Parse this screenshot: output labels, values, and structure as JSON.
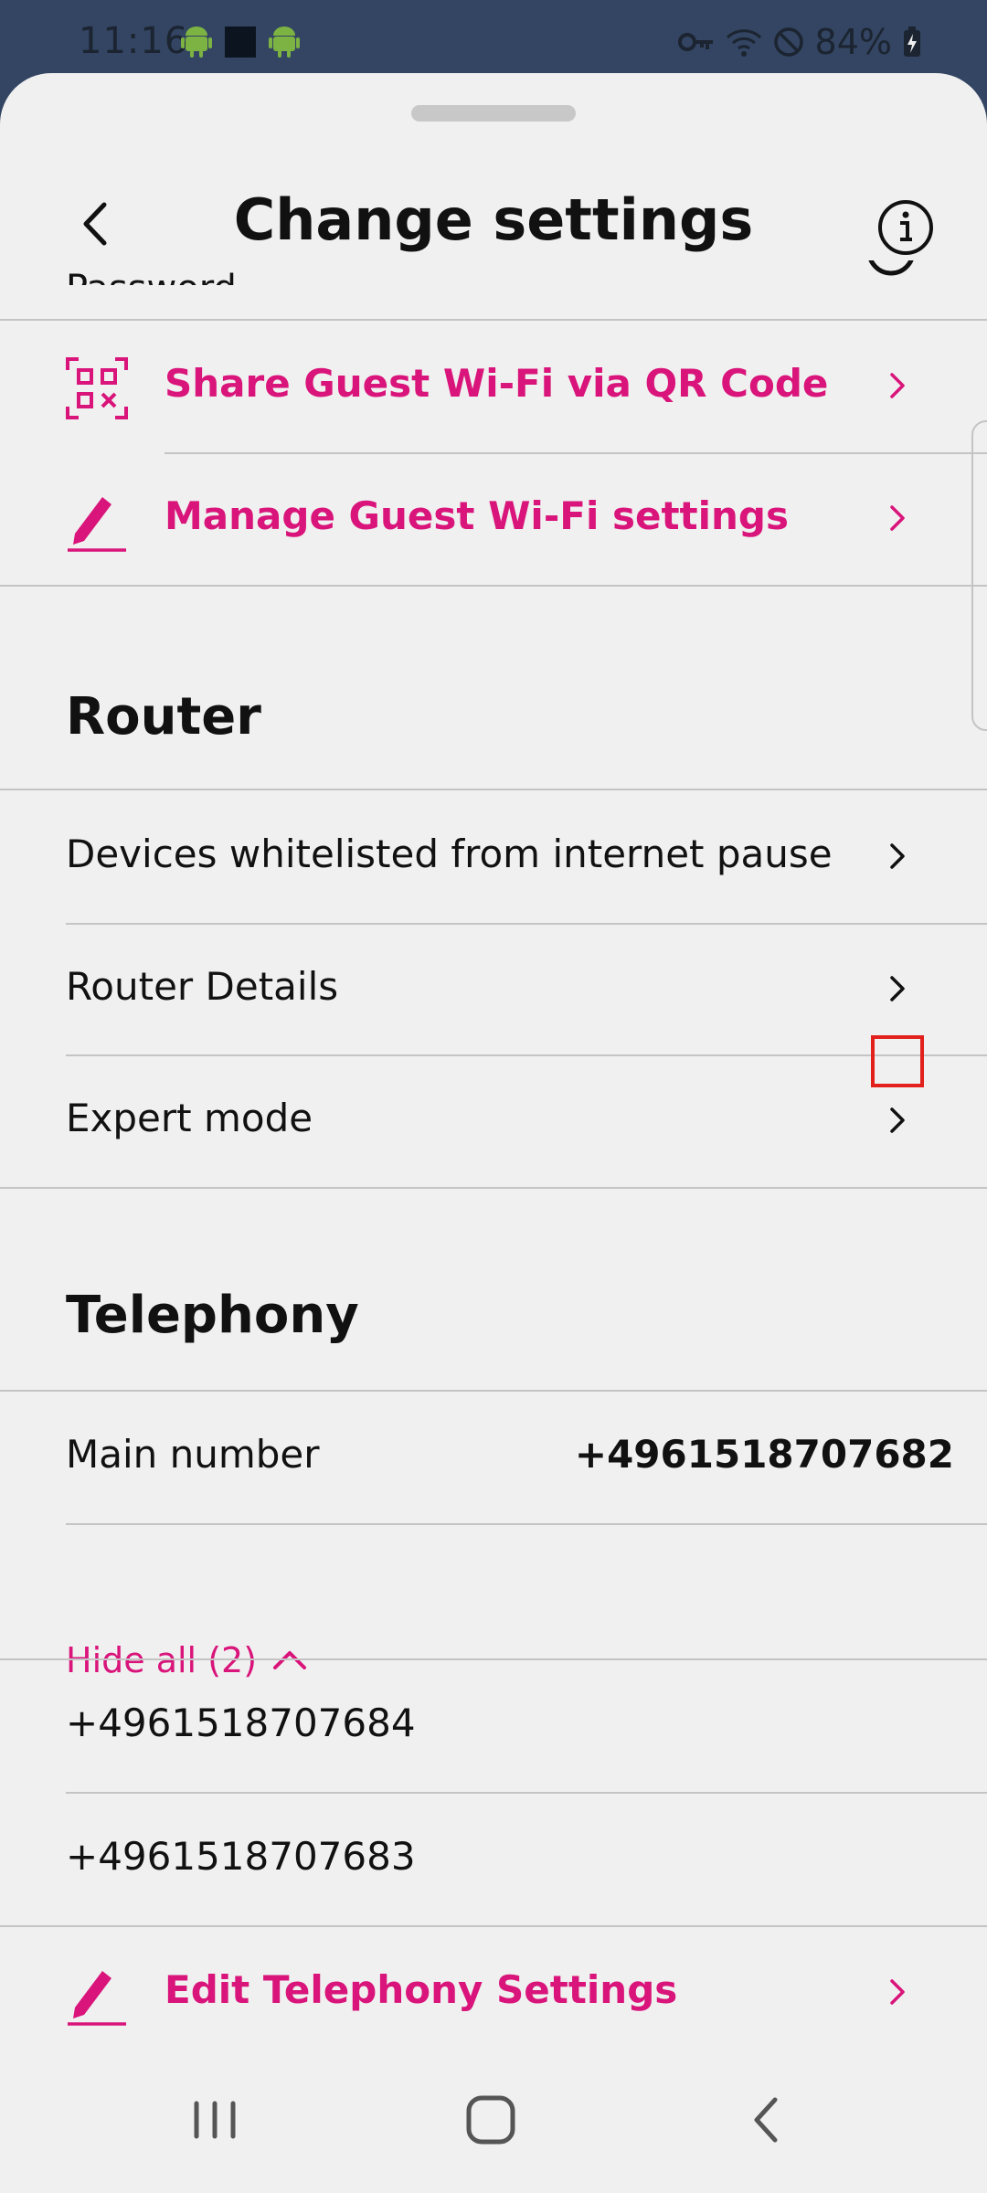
{
  "status_bar": {
    "time": "11:16",
    "battery": "84%"
  },
  "header": {
    "title": "Change settings",
    "clipped_label": "Password"
  },
  "guest_wifi": {
    "share_label": "Share Guest Wi-Fi via QR Code",
    "manage_label": "Manage Guest Wi-Fi settings"
  },
  "router": {
    "heading": "Router",
    "items": [
      {
        "label": "Devices whitelisted from internet pause"
      },
      {
        "label": "Router Details"
      },
      {
        "label": "Expert mode"
      }
    ]
  },
  "telephony": {
    "heading": "Telephony",
    "main_number_label": "Main number",
    "main_number_value": "+4961518707682",
    "hide_all_label": "Hide all (2)",
    "numbers": [
      "+4961518707684",
      "+4961518707683"
    ],
    "edit_label": "Edit Telephony Settings"
  },
  "colors": {
    "accent": "#d9147a",
    "status_bar": "#334562",
    "background": "#f0f0f0",
    "highlight": "#e2211c"
  }
}
